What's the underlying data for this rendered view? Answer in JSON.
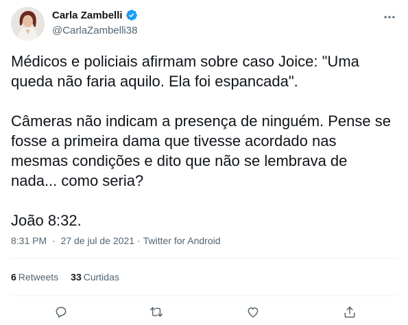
{
  "author": {
    "display_name": "Carla Zambelli",
    "handle": "@CarlaZambelli38",
    "verified": true,
    "verified_color": "#1d9bf0"
  },
  "tweet": {
    "paragraphs": [
      "Médicos e policiais afirmam sobre caso Joice: \"Uma queda não faria aquilo. Ela foi espancada\".",
      "Câmeras não indicam a presença de ninguém. Pense se fosse a primeira dama que tivesse acordado nas mesmas condições e dito que não se lembrava de nada... como seria?",
      "João 8:32."
    ]
  },
  "meta": {
    "time": "8:31 PM",
    "separator": "·",
    "date": "27 de jul de 2021",
    "source": "Twitter for Android"
  },
  "stats": {
    "retweets_count": "6",
    "retweets_label": "Retweets",
    "likes_count": "33",
    "likes_label": "Curtidas"
  },
  "icons": {
    "more": "more-horizontal-icon",
    "reply": "reply-icon",
    "retweet": "retweet-icon",
    "like": "like-icon",
    "share": "share-icon"
  },
  "colors": {
    "text_primary": "#0f1419",
    "text_secondary": "#536471",
    "divider": "#eff3f4"
  }
}
